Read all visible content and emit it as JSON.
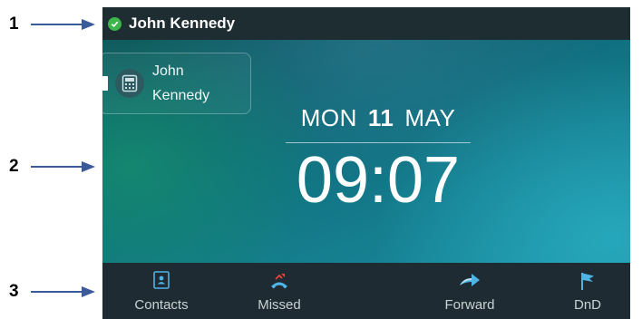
{
  "callouts": [
    "1",
    "2",
    "3"
  ],
  "status_bar": {
    "account_name": "John Kennedy",
    "status_icon": "presence-available-icon"
  },
  "line_key": {
    "label_line1": "John",
    "label_line2": "Kennedy",
    "icon": "phone-handset-icon"
  },
  "clock": {
    "day": "MON",
    "date": "11",
    "month": "MAY",
    "time": "09:07"
  },
  "softkeys": [
    {
      "label": "Contacts",
      "icon": "contacts-book-icon"
    },
    {
      "label": "Missed",
      "icon": "missed-call-icon"
    },
    {
      "label": "",
      "icon": ""
    },
    {
      "label": "Forward",
      "icon": "forward-arrow-icon"
    },
    {
      "label": "DnD",
      "icon": "flag-icon"
    }
  ],
  "colors": {
    "status_bar": "#1e2d32",
    "softkey_bar": "#1e2b32",
    "presence_green": "#3cb54a",
    "icon_blue": "#4fb3e6"
  }
}
